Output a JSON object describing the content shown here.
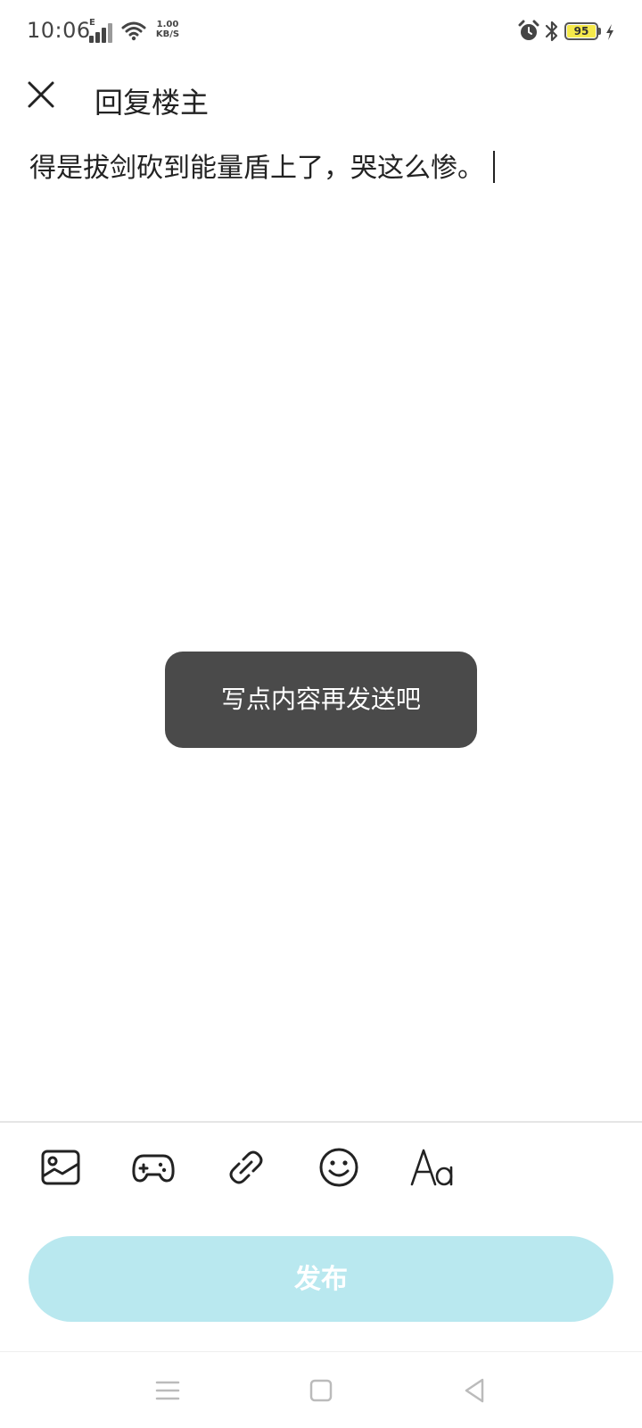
{
  "status_bar": {
    "time": "10:06",
    "signal_label": "E",
    "net_speed_value": "1.00",
    "net_speed_unit": "KB/S",
    "battery_level": "95",
    "icons": [
      "signal-icon",
      "wifi-icon",
      "alarm-icon",
      "bluetooth-icon",
      "battery-icon",
      "charging-icon"
    ]
  },
  "header": {
    "title": "回复楼主",
    "close_icon": "close-icon"
  },
  "editor": {
    "content": "得是拔剑砍到能量盾上了，哭这么惨。"
  },
  "toast": {
    "message": "写点内容再发送吧"
  },
  "toolbar": {
    "items": [
      {
        "name": "image-icon"
      },
      {
        "name": "gamepad-icon"
      },
      {
        "name": "link-icon"
      },
      {
        "name": "emoji-icon"
      },
      {
        "name": "text-format-icon"
      }
    ]
  },
  "publish": {
    "label": "发布",
    "color": "#b9e8ef"
  },
  "nav_bar": {
    "items": [
      "menu-icon",
      "home-icon",
      "back-icon"
    ]
  }
}
